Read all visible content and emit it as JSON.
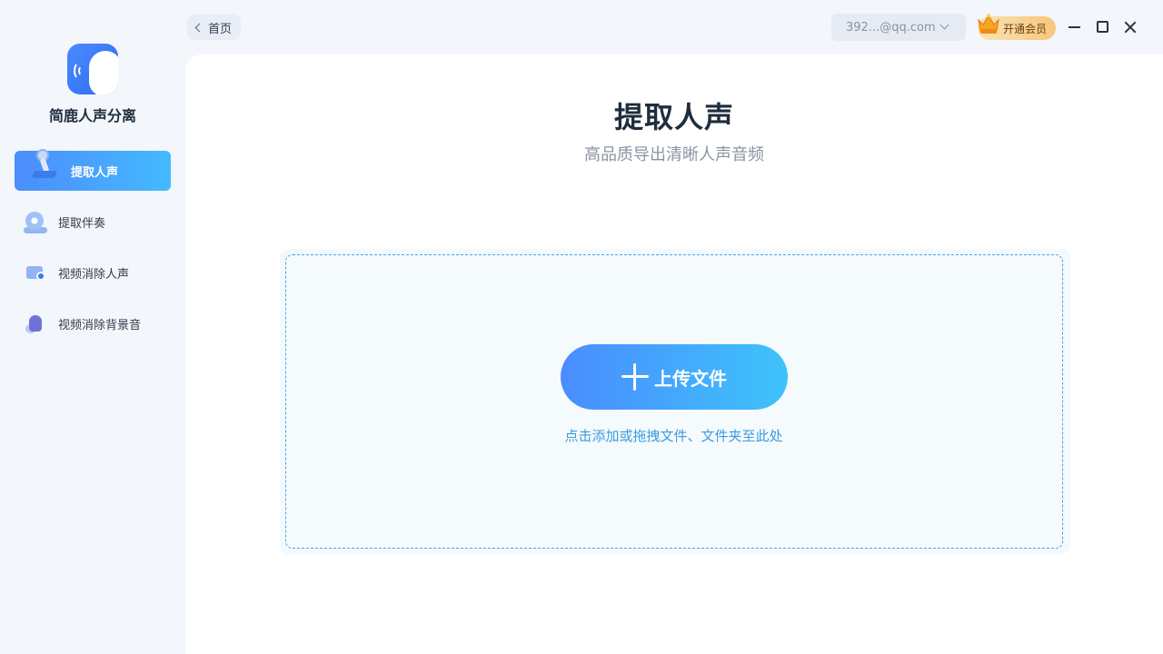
{
  "app": {
    "name": "简鹿人声分离"
  },
  "sidebar": {
    "items": [
      {
        "label": "提取人声",
        "icon": "microphone-icon",
        "active": true
      },
      {
        "label": "提取伴奏",
        "icon": "disc-icon",
        "active": false
      },
      {
        "label": "视频消除人声",
        "icon": "video-icon",
        "active": false
      },
      {
        "label": "视频消除背景音",
        "icon": "speaker-icon",
        "active": false
      }
    ]
  },
  "topbar": {
    "back_label": "首页",
    "account": "392...@qq.com",
    "vip_label": "开通会员"
  },
  "main": {
    "title": "提取人声",
    "subtitle": "高品质导出清晰人声音频",
    "upload_label": "上传文件",
    "drop_hint": "点击添加或拖拽文件、文件夹至此处"
  },
  "colors": {
    "accent": "#4a8cff",
    "accent_end": "#3ec3fb",
    "hint": "#3a9be0",
    "vip_gold": "#f6c77c"
  }
}
